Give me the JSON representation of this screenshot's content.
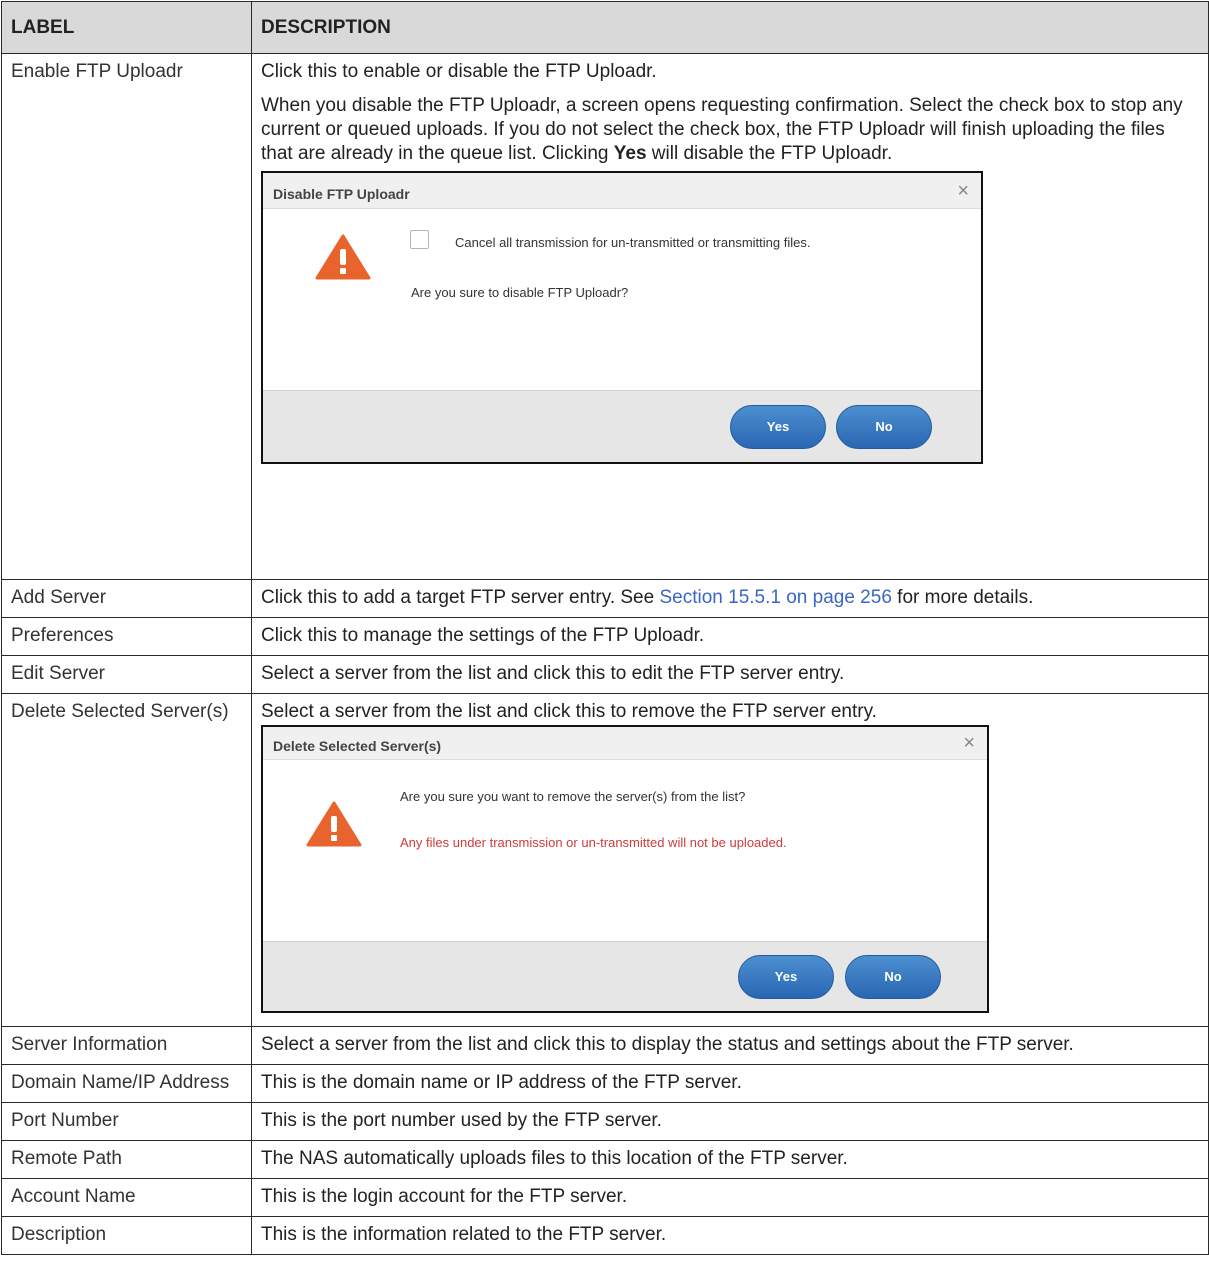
{
  "header": {
    "label": "LABEL",
    "description": "DESCRIPTION"
  },
  "rows": {
    "enable": {
      "label": "Enable FTP Uploadr",
      "p1": "Click this to enable or disable the FTP Uploadr.",
      "p2_a": "When you disable the FTP Uploadr, a screen opens requesting confirmation. Select the check box to stop any current or queued uploads. If you do not select the check box, the FTP Uploadr will finish uploading the files that are already in the queue list. Clicking ",
      "p2_bold": "Yes",
      "p2_b": " will disable the FTP Uploadr.",
      "dialog": {
        "title": "Disable FTP Uploadr",
        "close": "×",
        "checkbox_label": "Cancel all transmission for un-transmitted or transmitting files.",
        "question": "Are you sure to disable FTP Uploadr?",
        "yes": "Yes",
        "no": "No"
      }
    },
    "add_server": {
      "label": "Add Server",
      "desc_a": "Click this to add a target FTP server entry. See ",
      "desc_link": "Section 15.5.1 on page 256",
      "desc_b": " for more details."
    },
    "preferences": {
      "label": "Preferences",
      "desc": "Click this to manage the settings of the FTP Uploadr."
    },
    "edit_server": {
      "label": "Edit Server",
      "desc": "Select a server from the list and click this to edit the FTP server entry."
    },
    "delete_server": {
      "label": "Delete Selected Server(s)",
      "desc": "Select a server from the list and click this to remove the FTP server entry.",
      "dialog": {
        "title": "Delete Selected Server(s)",
        "close": "×",
        "question": "Are you sure you want to remove the server(s) from the list?",
        "warning": "Any files under transmission or un-transmitted will not be uploaded.",
        "yes": "Yes",
        "no": "No"
      }
    },
    "server_info": {
      "label": "Server Information",
      "desc": "Select a server from the list and click this to display the status and settings about the FTP server."
    },
    "domain": {
      "label": "Domain Name/IP Address",
      "desc": "This is the domain name or IP address of the FTP server."
    },
    "port": {
      "label": "Port Number",
      "desc": "This is the port number used by the FTP server."
    },
    "remote_path": {
      "label": "Remote Path",
      "desc": "The NAS automatically uploads files to this location of the FTP server."
    },
    "account": {
      "label": "Account Name",
      "desc": "This is the login account for the FTP server."
    },
    "description": {
      "label": "Description",
      "desc": "This is the information related to the FTP server."
    }
  },
  "colors": {
    "link": "#3a66c8",
    "warning_icon": "#e8642c",
    "warning_text": "#d23a3a",
    "button": "#2f6fb8",
    "header_bg": "#d9d9d9"
  },
  "icons": {
    "warning": "warning-triangle-icon",
    "close": "close-icon",
    "checkbox": "checkbox-icon"
  }
}
